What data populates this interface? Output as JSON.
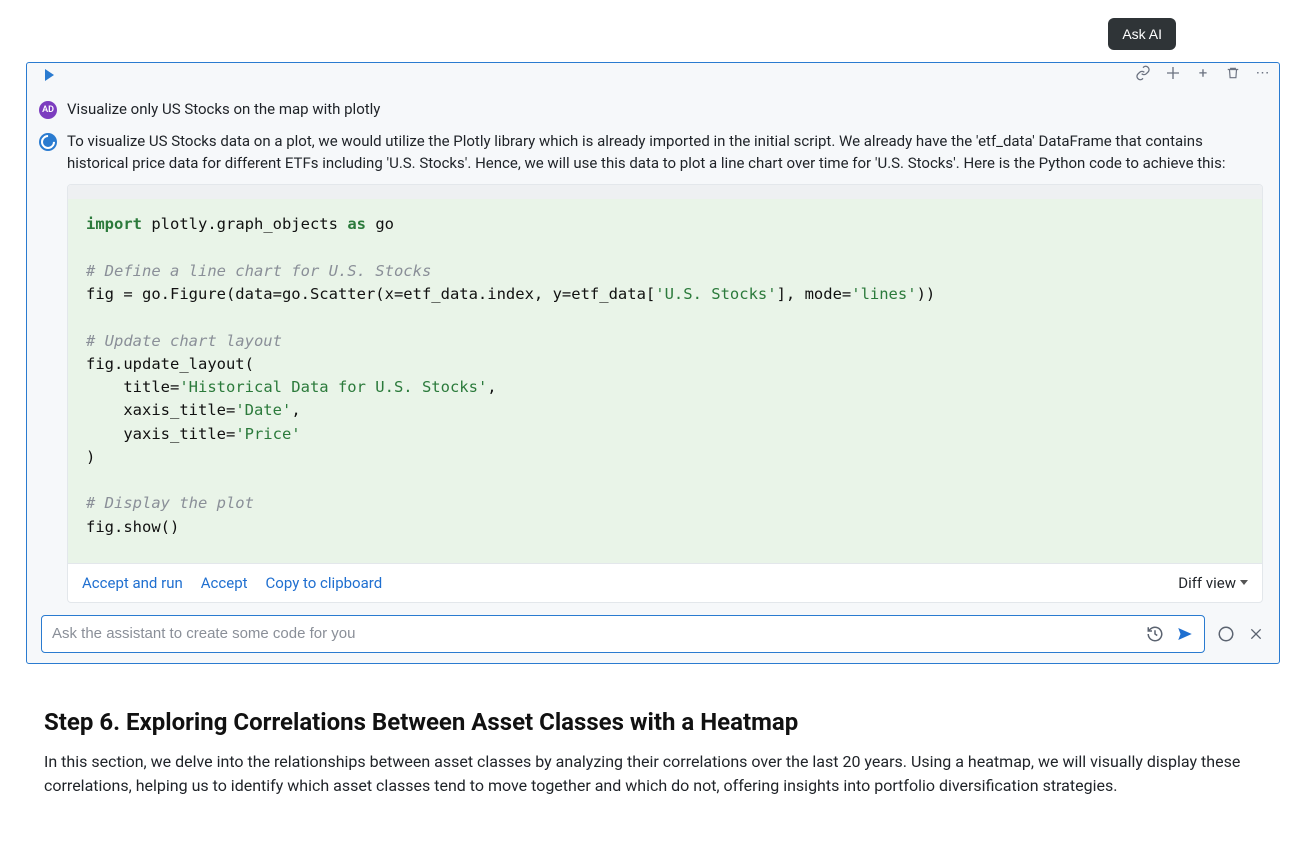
{
  "ask_ai_button": "Ask AI",
  "chat": {
    "user_avatar_text": "AD",
    "user_prompt": "Visualize only US Stocks on the map with plotly",
    "ai_response": "To visualize US Stocks data on a plot, we would utilize the Plotly library which is already imported in the initial script. We already have the 'etf_data' DataFrame that contains historical price data for different ETFs including 'U.S. Stocks'. Hence, we will use this data to plot a line chart over time for 'U.S. Stocks'. Here is the Python code to achieve this:"
  },
  "code": {
    "l1_kw1": "import",
    "l1_mod": " plotly.graph_objects ",
    "l1_kw2": "as",
    "l1_alias": " go",
    "l3_comm": "# Define a line chart for U.S. Stocks",
    "l4_a": "fig = go.Figure(data=go.Scatter(x=etf_data.index, y=etf_data[",
    "l4_str": "'U.S. Stocks'",
    "l4_b": "], mode=",
    "l4_str2": "'lines'",
    "l4_c": "))",
    "l6_comm": "# Update chart layout",
    "l7": "fig.update_layout(",
    "l8_a": "    title=",
    "l8_str": "'Historical Data for U.S. Stocks'",
    "l8_b": ",",
    "l9_a": "    xaxis_title=",
    "l9_str": "'Date'",
    "l9_b": ",",
    "l10_a": "    yaxis_title=",
    "l10_str": "'Price'",
    "l11": ")",
    "l13_comm": "# Display the plot",
    "l14": "fig.show()"
  },
  "actions": {
    "accept_and_run": "Accept and run",
    "accept": "Accept",
    "copy": "Copy to clipboard",
    "diff_view": "Diff view"
  },
  "prompt_placeholder": "Ask the assistant to create some code for you",
  "step6": {
    "heading": "Step 6. Exploring Correlations Between Asset Classes with a Heatmap",
    "para": "In this section, we delve into the relationships between asset classes by analyzing their correlations over the last 20 years. Using a heatmap, we will visually display these correlations, helping us to identify which asset classes tend to move together and which do not, offering insights into portfolio diversification strategies."
  }
}
